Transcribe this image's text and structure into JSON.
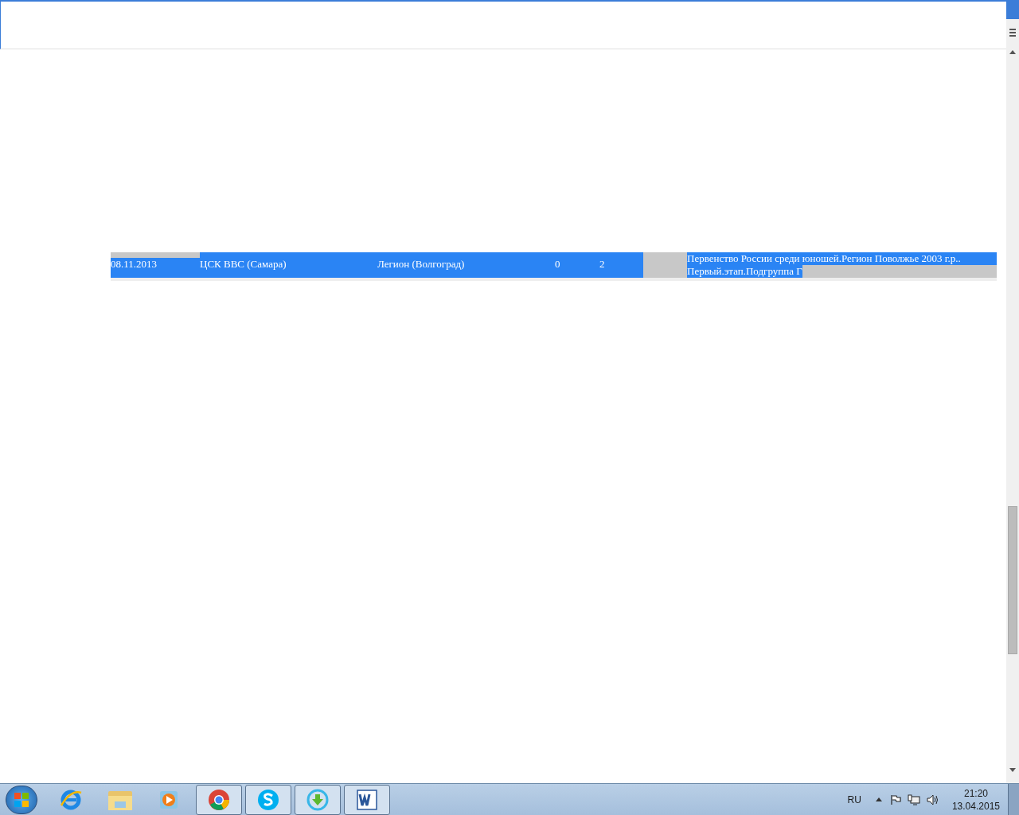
{
  "rows": [
    {
      "date": "08.11.2013",
      "home": "ЦСК ВВС (Самара)",
      "away": "Легион (Волгоград)",
      "score_home": "0",
      "score_away": "2",
      "tournament_lines": [
        "Первенство России среди юношей.Регион Поволжье 2003 г.р..",
        "Первый.этап.Подгруппа Г"
      ],
      "selected": true
    }
  ],
  "taskbar": {
    "pinned": [
      {
        "kind": "ie",
        "active": false
      },
      {
        "kind": "explorer",
        "active": false
      },
      {
        "kind": "media",
        "active": false
      },
      {
        "kind": "chrome",
        "active": true
      },
      {
        "kind": "skype",
        "active": true
      },
      {
        "kind": "download",
        "active": true
      },
      {
        "kind": "word",
        "active": true
      }
    ],
    "language": "RU",
    "time": "21:20",
    "date": "13.04.2015"
  }
}
